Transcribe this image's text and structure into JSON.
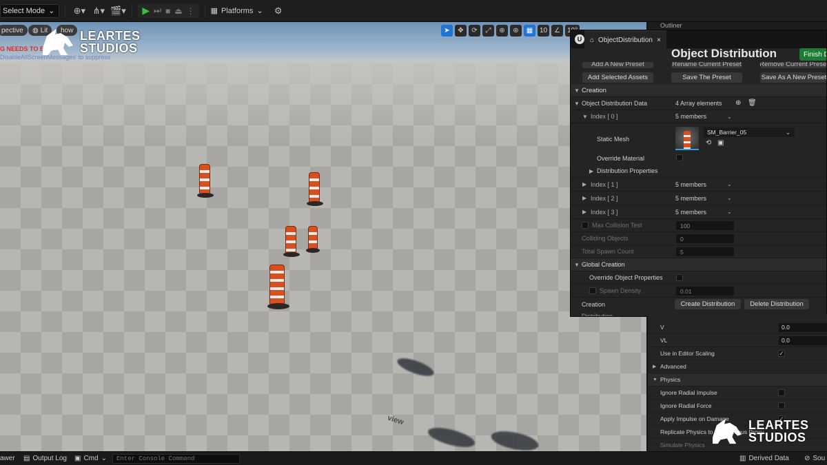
{
  "toolbar": {
    "select_mode": "Select Mode",
    "platforms": "Platforms"
  },
  "viewport": {
    "perspective": "pective",
    "lit": "Lit",
    "show": "how",
    "error_text": "G NEEDS TO BE R",
    "error_sub": "DisableAllScreenMessages' to suppress",
    "grid_snap": "10",
    "rot_snap": "10°",
    "watermark": "view"
  },
  "logo": {
    "line1": "LEARTES",
    "line2": "STUDIOS"
  },
  "outliner": {
    "label": "Outliner"
  },
  "object_distribution": {
    "tab_label": "ObjectDistribution",
    "title": "Object Distribution",
    "finish_button": "Finish Di",
    "buttons": {
      "add_preset": "Add A New Preset",
      "rename_preset": "Rename Current Preset",
      "remove_preset": "Remove Current Preset",
      "add_selected": "Add Selected Assets",
      "save_preset": "Save The Preset",
      "save_as_preset": "Save As A New Preset"
    },
    "creation_section": "Creation",
    "data_label": "Object Distribution Data",
    "data_value": "4 Array elements",
    "index0": "Index [ 0 ]",
    "index0_members": "5 members",
    "static_mesh_label": "Static Mesh",
    "static_mesh_value": "SM_Barrier_05",
    "override_material": "Override Material",
    "distribution_properties": "Distribution Properties",
    "index1": "Index [ 1 ]",
    "index1_members": "5 members",
    "index2": "Index [ 2 ]",
    "index2_members": "5 members",
    "index3": "Index [ 3 ]",
    "index3_members": "5 members",
    "max_collision_label": "Max Collision Test",
    "max_collision_value": "100",
    "colliding_label": "Colliding Objects",
    "colliding_value": "0",
    "spawn_count_label": "Total Spawn Count",
    "spawn_count_value": "5",
    "global_creation": "Global Creation",
    "override_props": "Override Object Properties",
    "spawn_density_label": "Spawn Density",
    "spawn_density_value": "0.01",
    "creation_label": "Creation",
    "create_button": "Create Distribution",
    "delete_button": "Delete Distribution",
    "cut_section": "Distribution"
  },
  "details": {
    "v_label": "V",
    "v_value": "0.0",
    "vl_label": "VL",
    "vl_value": "0.0",
    "editor_scaling": "Use in Editor Scaling",
    "advanced": "Advanced",
    "physics": "Physics",
    "ignore_radial_impulse": "Ignore Radial Impulse",
    "ignore_radial_force": "Ignore Radial Force",
    "apply_impulse": "Apply Impulse on Damage",
    "replicate_physics": "Replicate Physics to Autonomous Proxy",
    "simulate_physics": "Simulate Physics"
  },
  "statusbar": {
    "drawer": "awer",
    "output_log": "Output Log",
    "cmd": "Cmd",
    "console_placeholder": "Enter Console Command",
    "derived_data": "Derived Data",
    "source": "Sou"
  }
}
